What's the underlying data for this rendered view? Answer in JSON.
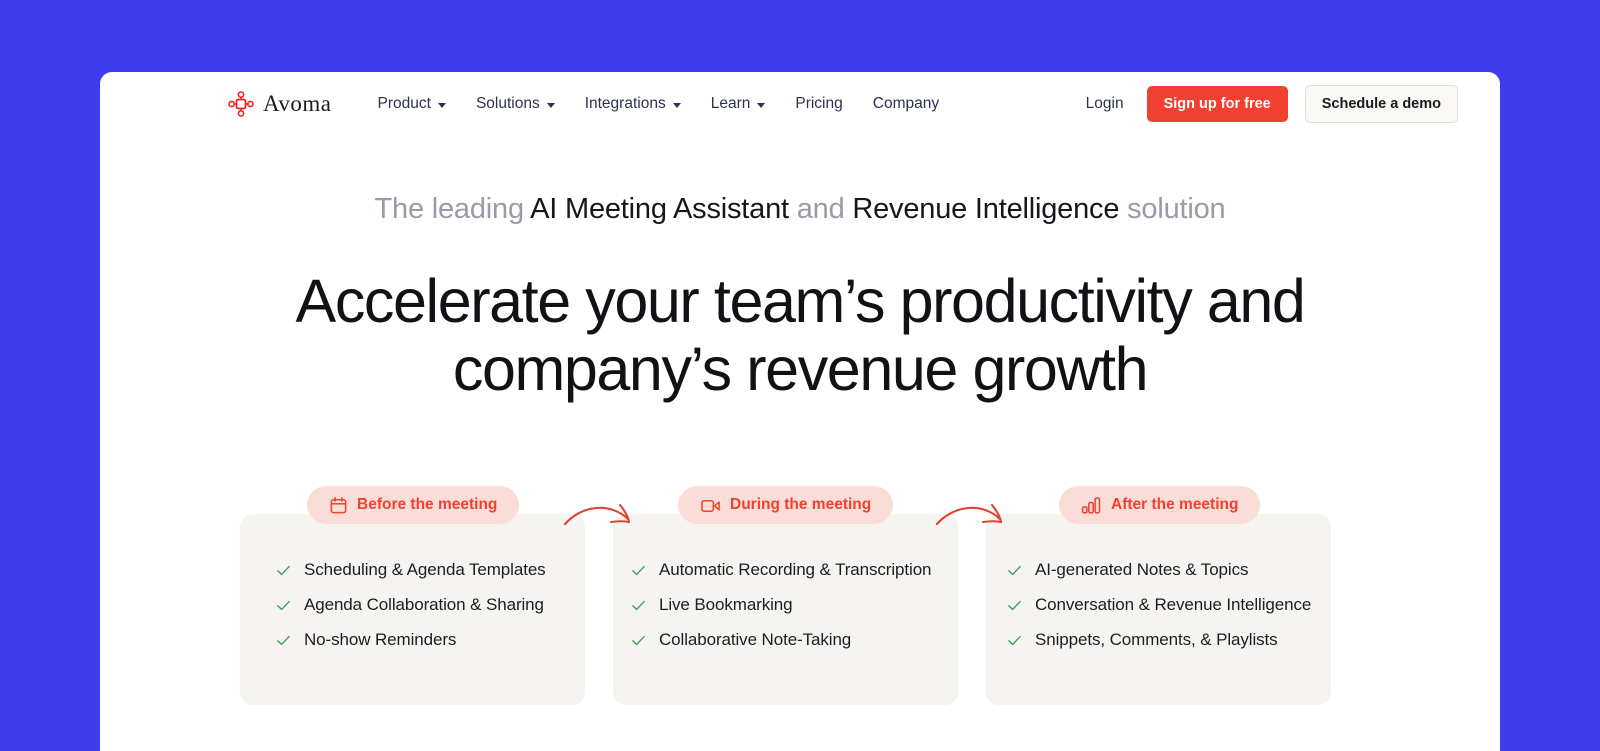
{
  "theme": {
    "page_background": "#3F3CEF",
    "panel_background": "#FFFFFF",
    "accent_red": "#F04030",
    "badge_background": "#FBDDD7",
    "card_background": "#F5F4F1",
    "check_green": "#3E9E5E",
    "nav_text": "#2D3250",
    "muted_text": "#9A9AA8"
  },
  "navbar": {
    "brand": {
      "name": "Avoma",
      "logo_icon": "avoma-node-logo-icon"
    },
    "links": [
      {
        "label": "Product",
        "has_dropdown": true
      },
      {
        "label": "Solutions",
        "has_dropdown": true
      },
      {
        "label": "Integrations",
        "has_dropdown": true
      },
      {
        "label": "Learn",
        "has_dropdown": true
      },
      {
        "label": "Pricing",
        "has_dropdown": false
      },
      {
        "label": "Company",
        "has_dropdown": false
      }
    ],
    "login_label": "Login",
    "signup_label": "Sign up for free",
    "demo_label": "Schedule a demo"
  },
  "hero": {
    "eyebrow": [
      {
        "text": "The leading ",
        "emphasis": false
      },
      {
        "text": "AI Meeting Assistant",
        "emphasis": true
      },
      {
        "text": " and ",
        "emphasis": false
      },
      {
        "text": "Revenue Intelligence",
        "emphasis": true
      },
      {
        "text": " solution",
        "emphasis": false
      }
    ],
    "headline": "Accelerate your team’s productivity and company’s revenue growth"
  },
  "stages": [
    {
      "badge_label": "Before the meeting",
      "badge_icon": "calendar-icon",
      "features": [
        "Scheduling & Agenda Templates",
        "Agenda Collaboration & Sharing",
        "No-show Reminders"
      ]
    },
    {
      "badge_label": "During the meeting",
      "badge_icon": "video-camera-icon",
      "features": [
        "Automatic Recording & Transcription",
        "Live Bookmarking",
        "Collaborative Note-Taking"
      ]
    },
    {
      "badge_label": "After the meeting",
      "badge_icon": "bar-chart-icon",
      "features": [
        "AI-generated Notes & Topics",
        "Conversation & Revenue Intelligence",
        "Snippets, Comments, & Playlists"
      ]
    }
  ],
  "connectors": [
    {
      "icon": "curved-arrow-right-icon"
    },
    {
      "icon": "curved-arrow-right-icon"
    }
  ]
}
